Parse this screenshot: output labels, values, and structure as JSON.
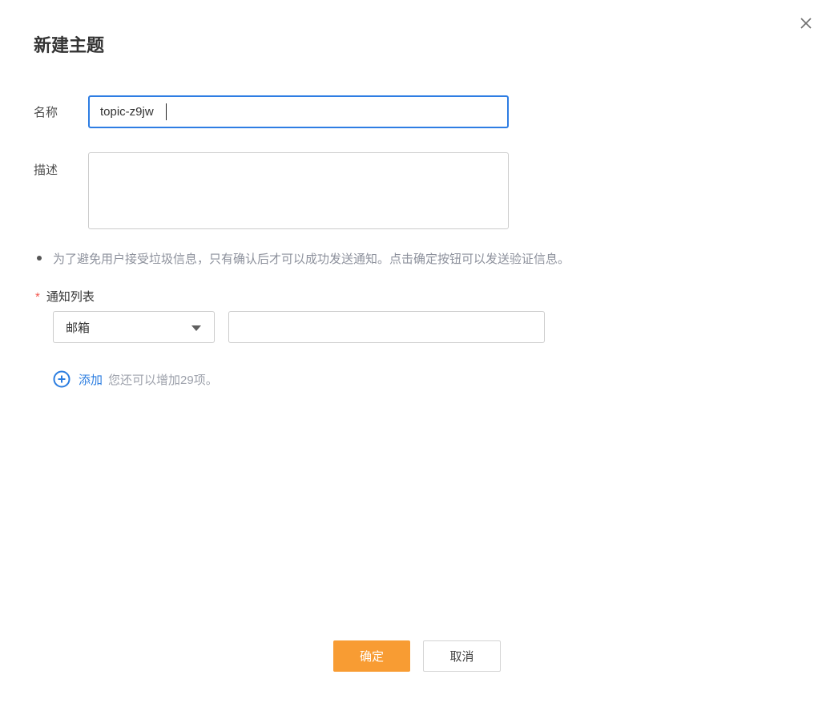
{
  "dialog": {
    "title": "新建主题"
  },
  "form": {
    "name_label": "名称",
    "name_value": "topic-z9jw",
    "desc_label": "描述",
    "desc_value": "",
    "notice": "为了避免用户接受垃圾信息，只有确认后才可以成功发送通知。点击确定按钮可以发送验证信息。",
    "notification": {
      "required_mark": "*",
      "label": "通知列表",
      "type_selected": "邮箱",
      "endpoint_value": "",
      "add_label": "添加",
      "add_hint": "您还可以增加29项。"
    }
  },
  "footer": {
    "confirm": "确定",
    "cancel": "取消"
  },
  "colors": {
    "accent_blue": "#2b7de0",
    "focus_border_blue": "#2e7de3",
    "primary_orange": "#f89c33",
    "required_red": "#f3574e"
  }
}
